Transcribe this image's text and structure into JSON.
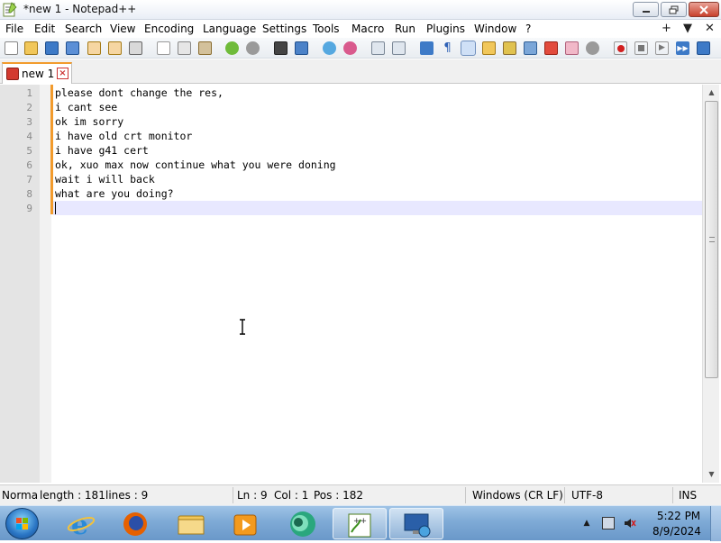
{
  "window": {
    "title": "*new 1 - Notepad++"
  },
  "menu": {
    "items": [
      "File",
      "Edit",
      "Search",
      "View",
      "Encoding",
      "Language",
      "Settings",
      "Tools",
      "Macro",
      "Run",
      "Plugins",
      "Window",
      "?"
    ],
    "right": [
      "+",
      "▼",
      "✕"
    ]
  },
  "toolbar": {
    "icons": [
      "new-file",
      "open-file",
      "save",
      "save-all",
      "close",
      "close-all",
      "print",
      "cut",
      "copy",
      "paste",
      "undo",
      "redo",
      "find",
      "replace",
      "zoom-in",
      "zoom-out",
      "sync-vertical",
      "sync-horizontal",
      "word-wrap",
      "show-all-characters",
      "indent-guide",
      "user-defined-language",
      "folder-as-workspace",
      "document-map",
      "function-list",
      "monitoring",
      "record-macro",
      "stop-recording",
      "playback-macro",
      "run-macro-multiple",
      "save-macro"
    ]
  },
  "tabs": [
    {
      "label": "new 1",
      "modified": true
    }
  ],
  "editor": {
    "lines": [
      "please dont change the res,",
      "i cant see",
      "ok im sorry",
      "i have old crt monitor",
      "i have g41 cert",
      "ok, xuo max now continue what you were doning",
      "wait i will back",
      "what are you doing?",
      ""
    ],
    "line_numbers": [
      "1",
      "2",
      "3",
      "4",
      "5",
      "6",
      "7",
      "8",
      "9"
    ],
    "current_line": 9
  },
  "status": {
    "doc_type": "Norma",
    "length": "length : 181",
    "lines": "lines : 9",
    "ln": "Ln : 9",
    "col": "Col : 1",
    "pos": "Pos : 182",
    "eol": "Windows (CR LF)",
    "encoding": "UTF-8",
    "mode": "INS"
  },
  "taskbar": {
    "apps": [
      "internet-explorer",
      "firefox",
      "file-explorer",
      "media-player",
      "app-green-circle",
      "notepad-plus-plus",
      "remote-desktop"
    ],
    "active_app": "notepad-plus-plus",
    "time": "5:22 PM",
    "date": "8/9/2024"
  },
  "colors": {
    "accent_orange": "#f29b2d",
    "current_line": "#e8e8ff",
    "taskbar": "#7eaad6"
  }
}
